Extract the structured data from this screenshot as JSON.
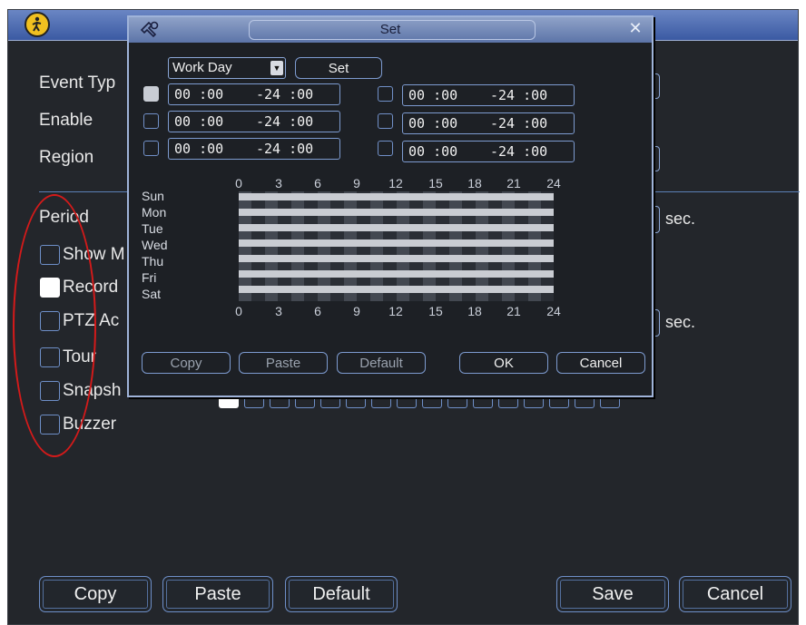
{
  "main": {
    "labels": {
      "event_type": "Event Typ",
      "enable": "Enable",
      "region": "Region",
      "period": "Period"
    },
    "options": [
      {
        "label": "Show M",
        "checked": false
      },
      {
        "label": "Record",
        "checked": true
      },
      {
        "label": "PTZ Ac",
        "checked": false
      },
      {
        "label": "Tour",
        "checked": false
      },
      {
        "label": "Snapsh",
        "checked": false
      },
      {
        "label": "Buzzer",
        "checked": false
      }
    ],
    "sec_label_1": "sec.",
    "sec_label_2": "sec.",
    "buttons": {
      "copy": "Copy",
      "paste": "Paste",
      "default": "Default",
      "save": "Save",
      "cancel": "Cancel"
    }
  },
  "set_dialog": {
    "title": "Set",
    "close_icon": "close-icon",
    "day_select": "Work Day",
    "set_button": "Set",
    "periods": [
      {
        "enabled": true,
        "start": "00 :00",
        "end": "-24 :00"
      },
      {
        "enabled": false,
        "start": "00 :00",
        "end": "-24 :00"
      },
      {
        "enabled": false,
        "start": "00 :00",
        "end": "-24 :00"
      },
      {
        "enabled": false,
        "start": "00 :00",
        "end": "-24 :00"
      },
      {
        "enabled": false,
        "start": "00 :00",
        "end": "-24 :00"
      },
      {
        "enabled": false,
        "start": "00 :00",
        "end": "-24 :00"
      }
    ],
    "hours": [
      "0",
      "3",
      "6",
      "9",
      "12",
      "15",
      "18",
      "21",
      "24"
    ],
    "days": [
      "Sun",
      "Mon",
      "Tue",
      "Wed",
      "Thu",
      "Fri",
      "Sat"
    ],
    "buttons": {
      "copy": "Copy",
      "paste": "Paste",
      "default": "Default",
      "ok": "OK",
      "cancel": "Cancel"
    }
  },
  "colors": {
    "background": "#23262b",
    "accent_border": "#6e8fc8",
    "titlebar": "#3b5aa3",
    "annotation": "#d41a1a"
  }
}
